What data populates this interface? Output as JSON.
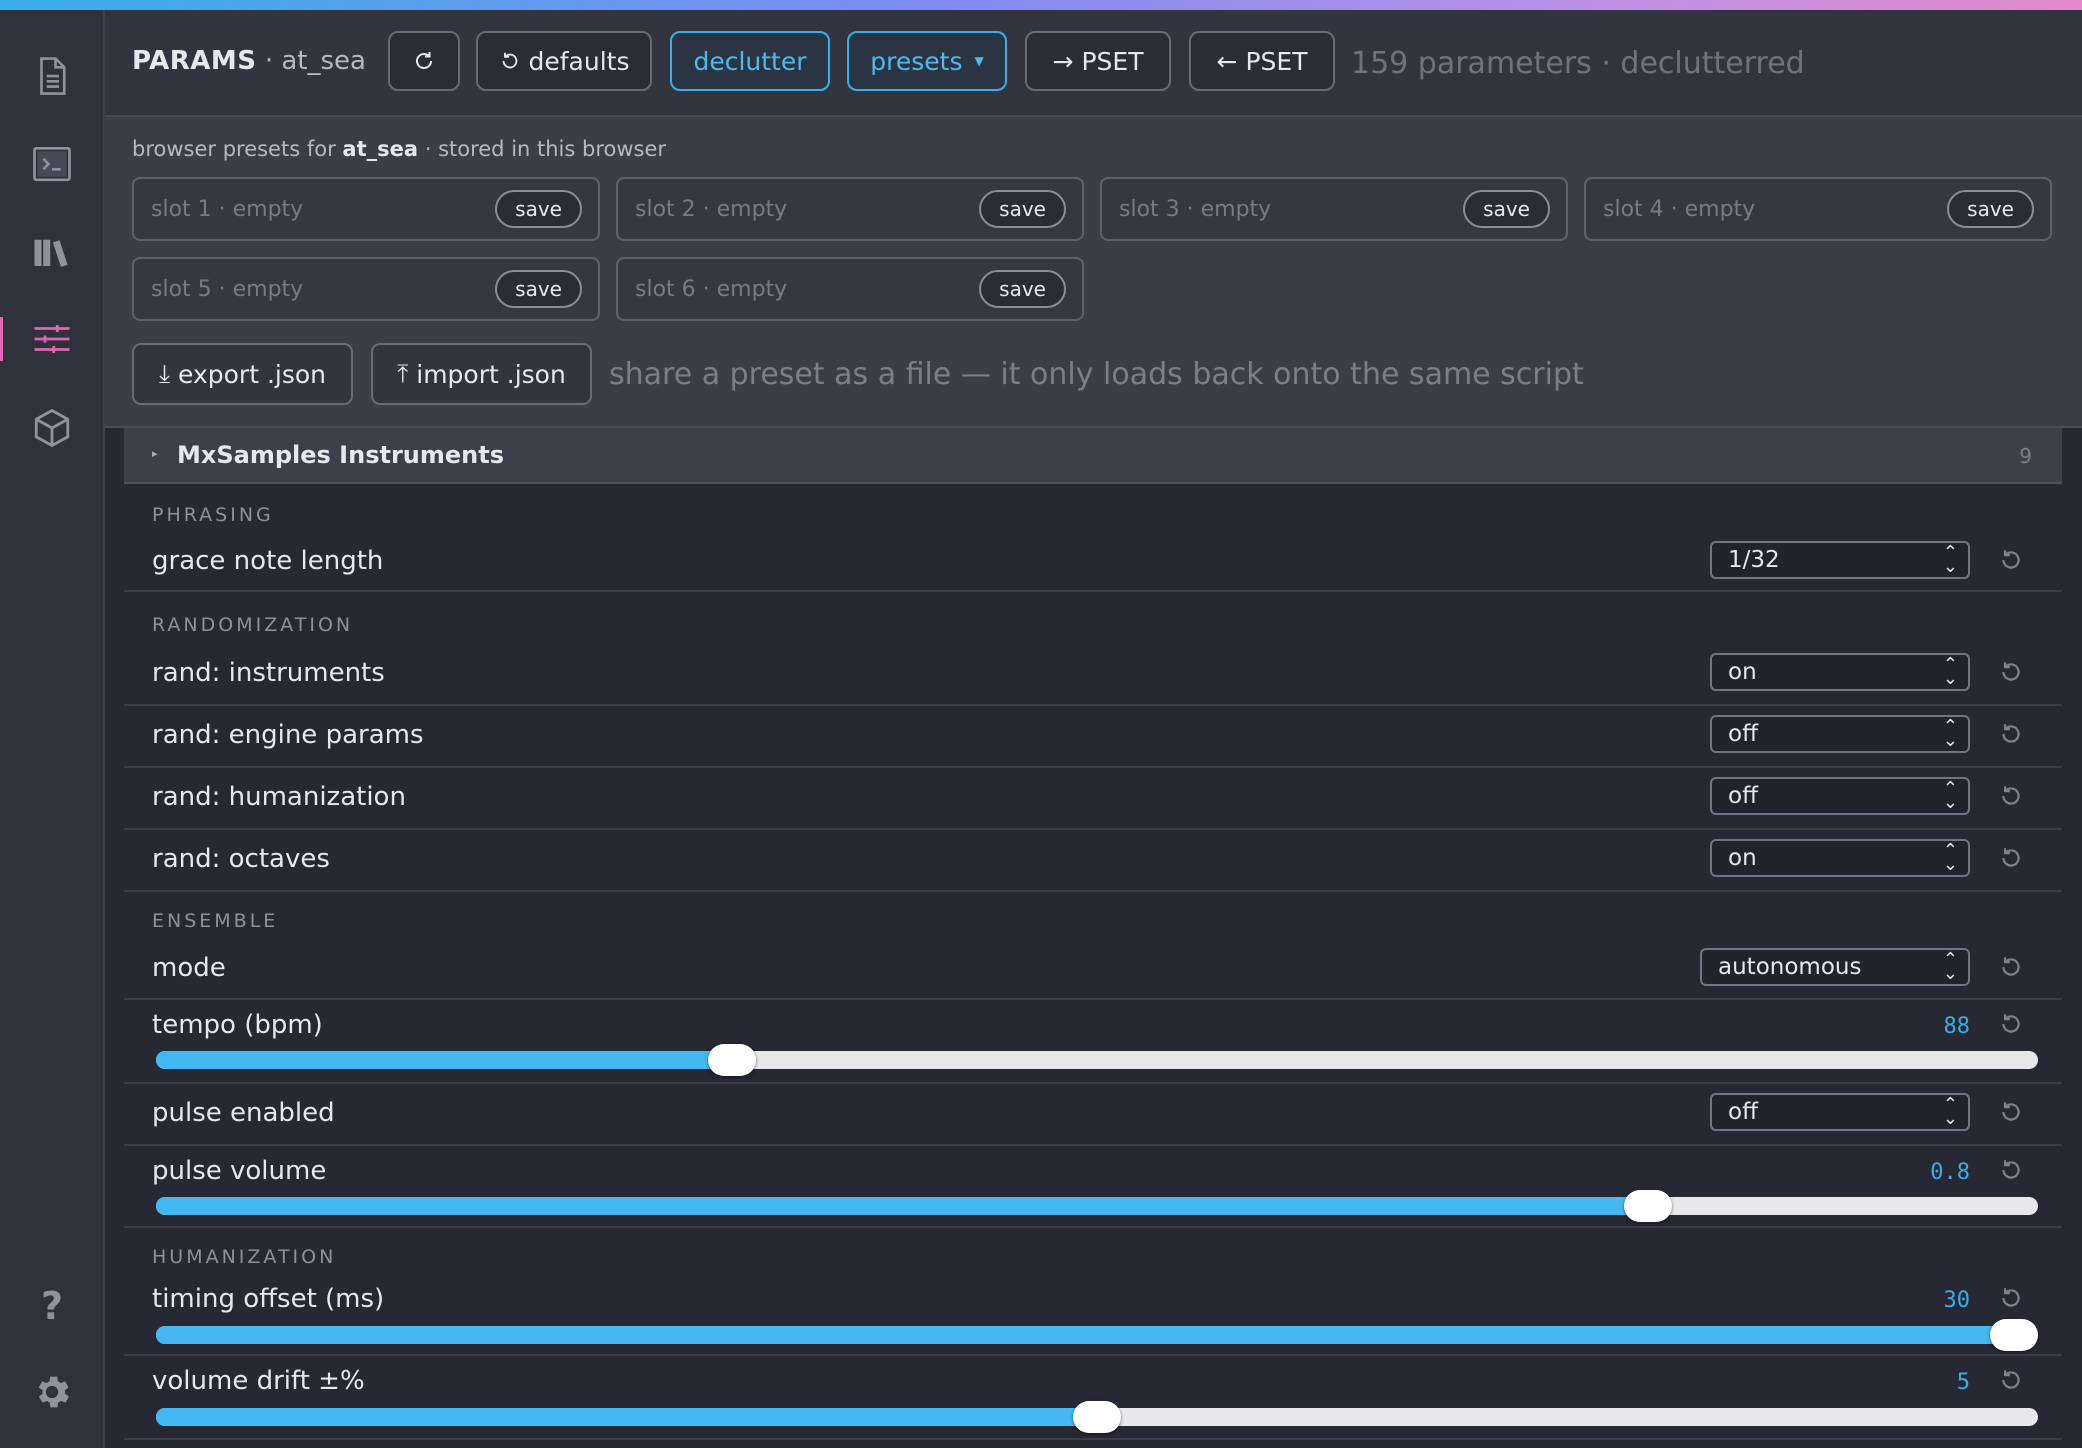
{
  "colors": {
    "accent": "#3aaee8",
    "active_nav": "#e066b4"
  },
  "sidebar": {
    "items": [
      {
        "icon": "document-icon",
        "active": false
      },
      {
        "icon": "terminal-icon",
        "active": false
      },
      {
        "icon": "library-icon",
        "active": false
      },
      {
        "icon": "sliders-icon",
        "active": true
      },
      {
        "icon": "cube-icon",
        "active": false
      }
    ],
    "help_label": "?",
    "settings_icon": "gear-icon"
  },
  "header": {
    "title": "PARAMS",
    "script_name": "at_sea",
    "defaults_label": "defaults",
    "declutter_label": "declutter",
    "presets_label": "presets",
    "to_pset_label": "PSET",
    "from_pset_label": "PSET",
    "status": "159 parameters · declutterred"
  },
  "presets_panel": {
    "caption_prefix": "browser presets for",
    "script_name": "at_sea",
    "caption_suffix": "· stored in this browser",
    "slots": [
      {
        "label": "slot 1 · empty",
        "save": "save"
      },
      {
        "label": "slot 2 · empty",
        "save": "save"
      },
      {
        "label": "slot 3 · empty",
        "save": "save"
      },
      {
        "label": "slot 4 · empty",
        "save": "save"
      },
      {
        "label": "slot 5 · empty",
        "save": "save"
      },
      {
        "label": "slot 6 · empty",
        "save": "save"
      }
    ],
    "export_label": "export .json",
    "import_label": "import .json",
    "hint": "share a preset as a file — it only loads back onto the same script"
  },
  "section": {
    "title": "MxSamples Instruments",
    "count": "9"
  },
  "groups": {
    "phrasing": "PHRASING",
    "randomization": "RANDOMIZATION",
    "ensemble": "ENSEMBLE",
    "humanization": "HUMANIZATION"
  },
  "params": {
    "grace_note_length": {
      "label": "grace note length",
      "value": "1/32"
    },
    "rand_instruments": {
      "label": "rand: instruments",
      "value": "on"
    },
    "rand_engine_params": {
      "label": "rand: engine params",
      "value": "off"
    },
    "rand_humanization": {
      "label": "rand: humanization",
      "value": "off"
    },
    "rand_octaves": {
      "label": "rand: octaves",
      "value": "on"
    },
    "mode": {
      "label": "mode",
      "value": "autonomous"
    },
    "tempo": {
      "label": "tempo (bpm)",
      "value": "88",
      "fraction": 0.306
    },
    "pulse_enabled": {
      "label": "pulse enabled",
      "value": "off"
    },
    "pulse_volume": {
      "label": "pulse volume",
      "value": "0.8",
      "fraction": 0.793
    },
    "timing_offset": {
      "label": "timing offset (ms)",
      "value": "30",
      "fraction": 1.0
    },
    "volume_drift": {
      "label": "volume drift ±%",
      "value": "5",
      "fraction": 0.5
    }
  }
}
